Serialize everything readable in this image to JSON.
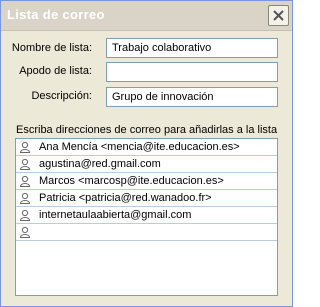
{
  "window": {
    "title": "Lista de correo"
  },
  "form": {
    "list_name_label": "Nombre de lista:",
    "list_name_value": "Trabajo colaborativo",
    "alias_label": "Apodo de lista:",
    "alias_value": "",
    "description_label": "Descripción:",
    "description_value": "Grupo de innovación"
  },
  "list": {
    "caption": "Escriba direcciones de correo para añadirlas a la lista",
    "entries": [
      "Ana Mencía <mencia@ite.educacion.es>",
      "agustina@red.gmail.com",
      "Marcos <marcosp@ite.educacion.es>",
      "Patricia <patricia@red.wanadoo.fr>",
      "internetaulaabierta@gmail.com",
      ""
    ]
  },
  "icons": {
    "close": "close-icon",
    "contact": "person-icon"
  }
}
